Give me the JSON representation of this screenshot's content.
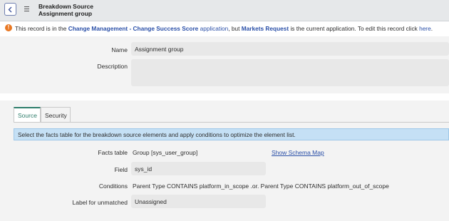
{
  "header": {
    "title": "Breakdown Source",
    "subtitle": "Assignment group",
    "back_icon": "chevron-left-icon",
    "menu_icon": "hamburger-icon"
  },
  "banner": {
    "icon": "!",
    "prefix": "This record is in the ",
    "scope_app": "Change Management - Change Success Score",
    "app_word": " application",
    "middle": ", but ",
    "current_app": "Markets Request",
    "suffix": " is the current application. To edit this record click ",
    "here": "here",
    "end": "."
  },
  "form": {
    "name_label": "Name",
    "name_value": "Assignment group",
    "description_label": "Description",
    "description_value": ""
  },
  "tabs": [
    {
      "label": "Source",
      "active": true
    },
    {
      "label": "Security",
      "active": false
    }
  ],
  "source": {
    "info": "Select the facts table for the breakdown source elements and apply conditions to optimize the element list.",
    "facts_table_label": "Facts table",
    "facts_table_value": "Group [sys_user_group]",
    "schema_link": "Show Schema Map",
    "field_label": "Field",
    "field_value": "sys_id",
    "conditions_label": "Conditions",
    "conditions_value": "Parent Type CONTAINS platform_in_scope .or. Parent Type CONTAINS platform_out_of_scope",
    "unmatched_label": "Label for unmatched",
    "unmatched_value": "Unassigned"
  },
  "colors": {
    "accent": "#2e7d6b",
    "link": "#2b50a8",
    "warning": "#e87722",
    "info_bg": "#c5e0f5"
  }
}
